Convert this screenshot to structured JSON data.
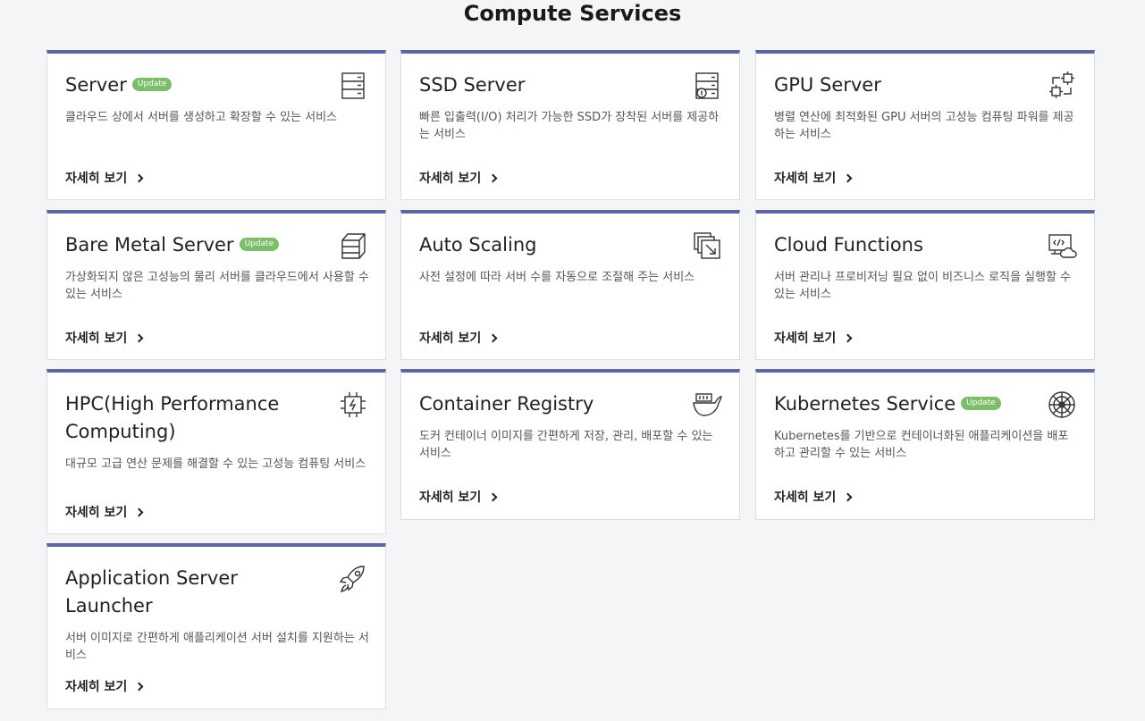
{
  "section_title": "Compute Services",
  "update_badge": "Update",
  "more_label": "자세히 보기",
  "accent_color": "#5f63a8",
  "badge_color": "#7cbe67",
  "cards": [
    {
      "title": "Server",
      "badge": true,
      "icon": "server-icon",
      "desc": "클라우드 상에서 서버를 생성하고 확장할 수 있는 서비스"
    },
    {
      "title": "SSD Server",
      "badge": false,
      "icon": "ssd-server-icon",
      "desc": "빠른 입출력(I/O) 처리가 가능한 SSD가 장착된 서버를 제공하는 서비스"
    },
    {
      "title": "GPU Server",
      "badge": false,
      "icon": "gpu-chip-icon",
      "desc": "병렬 연산에 최적화된 GPU 서버의 고성능 컴퓨팅 파워를 제공하는 서비스"
    },
    {
      "title": "Bare Metal Server",
      "badge": true,
      "icon": "bare-metal-cube-icon",
      "desc": "가상화되지 않은 고성능의 물리 서버를 클라우드에서 사용할 수 있는 서비스"
    },
    {
      "title": "Auto Scaling",
      "badge": false,
      "icon": "auto-scaling-icon",
      "desc": "사전 설정에 따라 서버 수를 자동으로 조절해 주는 서비스"
    },
    {
      "title": "Cloud Functions",
      "badge": false,
      "icon": "cloud-functions-icon",
      "desc": "서버 관리나 프로비저닝 필요 없이 비즈니스 로직을 실행할 수 있는 서비스"
    },
    {
      "title": "HPC(High Performance Computing)",
      "badge": false,
      "icon": "hpc-chip-icon",
      "desc": "대규모 고급 연산 문제를 해결할 수 있는 고성능 컴퓨팅 서비스"
    },
    {
      "title": "Container Registry",
      "badge": false,
      "icon": "container-registry-icon",
      "desc": "도커 컨테이너 이미지를 간편하게 저장, 관리, 배포할 수 있는 서비스"
    },
    {
      "title": "Kubernetes Service",
      "badge": true,
      "icon": "kubernetes-helm-icon",
      "desc": "Kubernetes를 기반으로 컨테이너화된 애플리케이션을 배포하고 관리할 수 있는 서비스"
    },
    {
      "title": "Application Server Launcher",
      "badge": false,
      "icon": "rocket-icon",
      "desc": "서버 이미지로 간편하게 애플리케이션 서버 설치를 지원하는 서비스"
    }
  ]
}
